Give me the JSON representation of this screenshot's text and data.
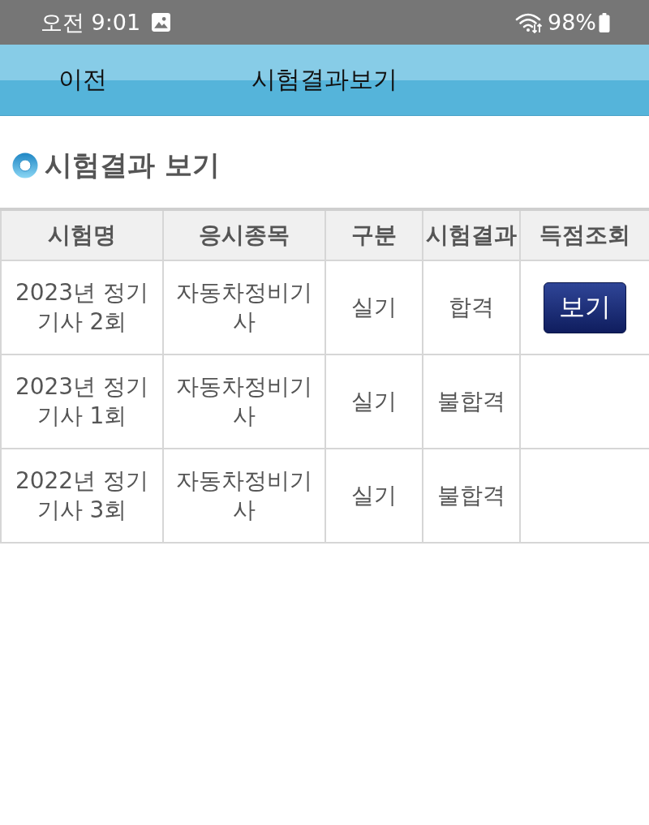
{
  "status_bar": {
    "time": "오전 9:01",
    "battery": "98%"
  },
  "header": {
    "back_button": "이전",
    "title": "시험결과보기"
  },
  "section": {
    "title": "시험결과 보기"
  },
  "table": {
    "columns": [
      "시험명",
      "응시종목",
      "구분",
      "시험결과",
      "득점조회"
    ],
    "rows": [
      {
        "cells": [
          "2023년 정기 기사 2회",
          "자동차정비기사",
          "실기",
          "합격"
        ],
        "action": "보기"
      },
      {
        "cells": [
          "2023년 정기 기사 1회",
          "자동차정비기사",
          "실기",
          "불합격"
        ]
      },
      {
        "cells": [
          "2022년 정기 기사 3회",
          "자동차정비기사",
          "실기",
          "불합격"
        ]
      }
    ]
  }
}
